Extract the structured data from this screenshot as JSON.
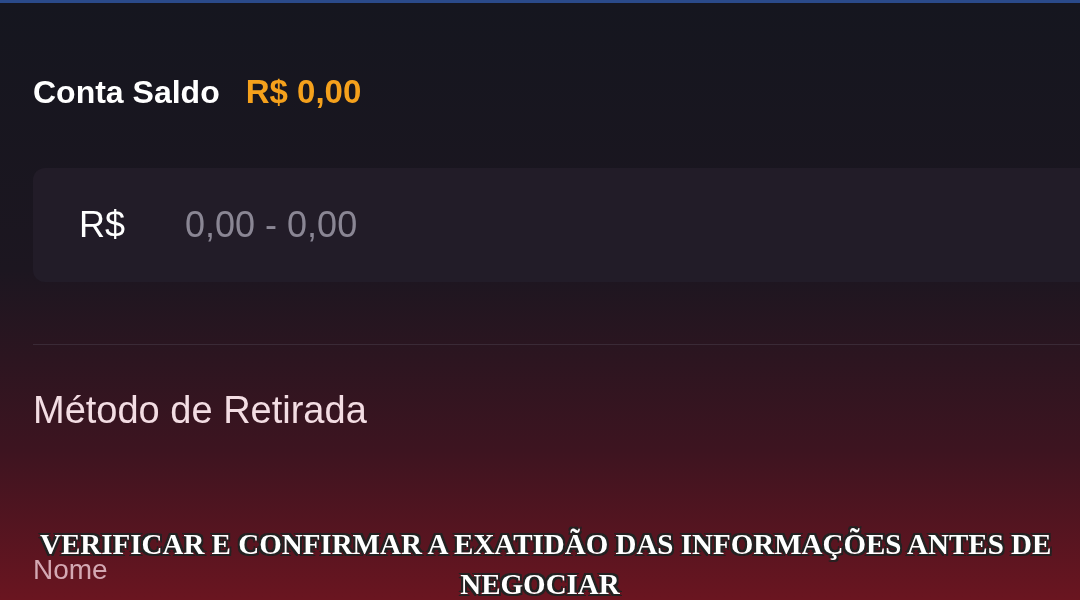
{
  "balance": {
    "label": "Conta Saldo",
    "value": "R$ 0,00"
  },
  "amount_field": {
    "currency": "R$",
    "placeholder": "0,00 - 0,00"
  },
  "withdrawal_method": {
    "title": "Método de Retirada"
  },
  "name_field": {
    "label": "Nome"
  },
  "caption_lines": [
    "VERIFICAR E CONFIRMAR A EXATIDÃO DAS INFORMAÇÕES ANTES DE",
    "NEGOCIAR"
  ]
}
